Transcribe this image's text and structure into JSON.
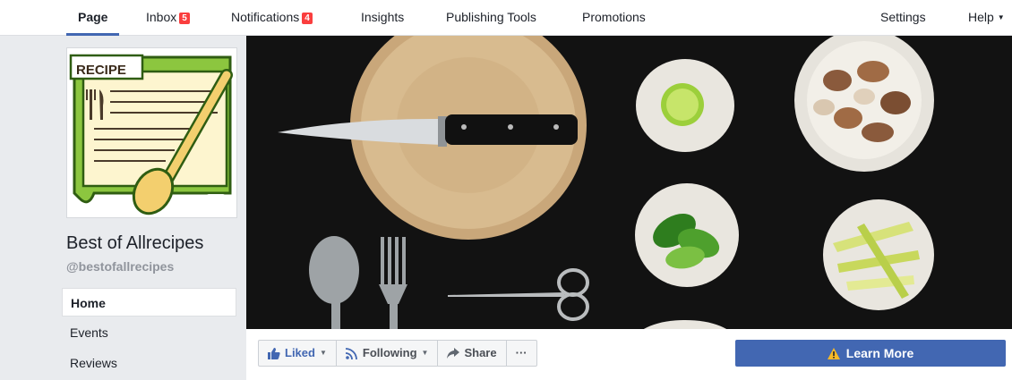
{
  "topnav": {
    "items": [
      {
        "label": "Page"
      },
      {
        "label": "Inbox",
        "badge": "5"
      },
      {
        "label": "Notifications",
        "badge": "4"
      },
      {
        "label": "Insights"
      },
      {
        "label": "Publishing Tools"
      },
      {
        "label": "Promotions"
      }
    ],
    "settings": "Settings",
    "help": "Help"
  },
  "profile": {
    "logo_text": "RECIPE",
    "name": "Best of Allrecipes",
    "handle": "@bestofallrecipes"
  },
  "sidebar": {
    "items": [
      {
        "label": "Home"
      },
      {
        "label": "Events"
      },
      {
        "label": "Reviews"
      }
    ]
  },
  "actions": {
    "liked": "Liked",
    "following": "Following",
    "share": "Share",
    "more": "···",
    "learn_more": "Learn More"
  },
  "colors": {
    "accent": "#4267b2",
    "badge": "#fa3e3e",
    "warning_icon": "#f7b928"
  }
}
